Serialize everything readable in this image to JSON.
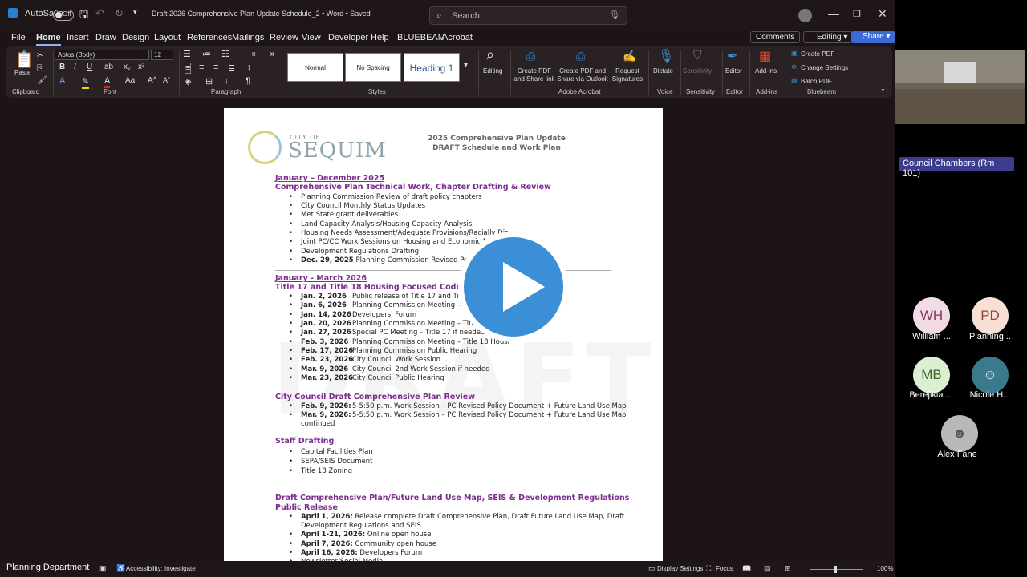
{
  "titlebar": {
    "autosave_label": "AutoSave",
    "autosave_state": "Off",
    "doc_title": "Draft 2026 Comprehensive Plan Update Schedule_2  •  Word • Saved",
    "search_placeholder": "Search"
  },
  "menu": [
    "File",
    "Home",
    "Insert",
    "Draw",
    "Design",
    "Layout",
    "References",
    "Mailings",
    "Review",
    "View",
    "Developer",
    "Help",
    "BLUEBEAM",
    "Acrobat"
  ],
  "menu_right": {
    "comments": "Comments",
    "editing": "Editing",
    "share": "Share"
  },
  "ribbon": {
    "paste": "Paste",
    "clipboard": "Clipboard",
    "font_name": "Aptos (Body)",
    "font_size": "12",
    "font": "Font",
    "paragraph": "Paragraph",
    "styles_group": "Styles",
    "style_normal": "Normal",
    "style_nospacing": "No Spacing",
    "style_heading1": "Heading 1",
    "editing": "Editing",
    "create_pdf_share": "Create PDF and Share link",
    "create_pdf_outlook": "Create PDF and Share via Outlook",
    "request_signatures": "Request Signatures",
    "adobe_acrobat": "Adobe Acrobat",
    "dictate": "Dictate",
    "voice": "Voice",
    "sensitivity": "Sensitivity",
    "editor": "Editor",
    "addins": "Add-ins",
    "bb_create_pdf": "Create PDF",
    "bb_change_settings": "Change Settings",
    "bb_batch_pdf": "Batch PDF",
    "bluebeam": "Bluebeam"
  },
  "document": {
    "logo_city": "CITY OF",
    "logo_name": "SEQUIM",
    "title_line1": "2025 Comprehensive Plan Update",
    "title_line2": "DRAFT Schedule and Work Plan",
    "watermark": "DRAFT",
    "sec1_date": "January – December 2025",
    "sec1_title": "Comprehensive Plan Technical Work, Chapter Drafting & Review",
    "sec1_items": [
      "Planning Commission Review of draft policy chapters",
      "City Council Monthly Status Updates",
      "Met State grant deliverables",
      "Land Capacity Analysis/Housing Capacity Analysis",
      "Housing Needs Assessment/Adequate Provisions/Racially Dis",
      "Joint PC/CC Work Sessions on Housing and Economic M",
      "Development Regulations Drafting"
    ],
    "sec1_last_date": "Dec. 29, 2025",
    "sec1_last_text": "Planning Commission Revised Policy",
    "sec2_date": "January - March 2026",
    "sec2_title": "Title 17 and Title 18 Housing Focused Code Amen",
    "sec2_items": [
      {
        "date": "Jan. 2, 2026",
        "text": "Public release of Title 17 and Tit"
      },
      {
        "date": "Jan. 6, 2026",
        "text": "Planning Commission Meeting – Ti"
      },
      {
        "date": "Jan. 14, 2026",
        "text": "Developers' Forum"
      },
      {
        "date": "Jan. 20, 2026",
        "text": "Planning Commission Meeting – Title"
      },
      {
        "date": "Jan. 27, 2026",
        "text": "Special PC Meeting – Title 17 if needed"
      },
      {
        "date": "Feb. 3, 2026",
        "text": "Planning Commission Meeting – Title 18 Housi"
      },
      {
        "date": "Feb. 17, 2026",
        "text": "Planning Commission Public Hearing"
      },
      {
        "date": "Feb. 23, 2026",
        "text": "City Council Work Session"
      },
      {
        "date": "Mar. 9, 2026",
        "text": "City Council 2nd Work Session if needed"
      },
      {
        "date": "Mar. 23, 2026",
        "text": "City Council Public Hearing"
      }
    ],
    "sec3_title": "City Council Draft Comprehensive Plan Review",
    "sec3_items": [
      {
        "date": "Feb. 9, 2026:",
        "text": "5-5:50 p.m. Work Session – PC Revised Policy Document + Future Land Use Map"
      },
      {
        "date": "Mar. 9, 2026:",
        "text": "5-5:50 p.m. Work Session – PC Revised Policy Document + Future Land Use Map"
      }
    ],
    "sec3_continued": "continued",
    "sec4_title": "Staff Drafting",
    "sec4_items": [
      "Capital Facilities Plan",
      "SEPA/SEIS Document",
      "Title 18 Zoning"
    ],
    "sec5_title_line1": "Draft Comprehensive Plan/Future Land Use Map, SEIS & Development Regulations",
    "sec5_title_line2": "Public Release",
    "sec5_items": [
      {
        "date": "April 1, 2026:",
        "text": "Release complete Draft Comprehensive Plan, Draft Future Land Use Map, Draft"
      },
      {
        "date": "",
        "text": "Development Regulations and SEIS"
      },
      {
        "date": "April 1-21, 2026:",
        "text": "Online open house"
      },
      {
        "date": "April 7, 2026:",
        "text": "Community open house"
      },
      {
        "date": "April 16, 2026:",
        "text": "Developers Forum"
      }
    ],
    "sec5_partial": "Newsletter/Social Media"
  },
  "statusbar": {
    "accessibility": "Accessibility: Investigate",
    "display_settings": "Display Settings",
    "focus": "Focus",
    "zoom": "100%"
  },
  "meeting": {
    "room_label": "Council Chambers (Rm 101)",
    "participants": [
      {
        "initials": "WH",
        "name": "William ..."
      },
      {
        "initials": "PD",
        "name": "Planning..."
      },
      {
        "initials": "MB",
        "name": "Berejikia..."
      },
      {
        "initials": "",
        "name": "Nicole H..."
      },
      {
        "initials": "",
        "name": "Alex Fane"
      }
    ],
    "presenter_label": "Planning Department"
  }
}
